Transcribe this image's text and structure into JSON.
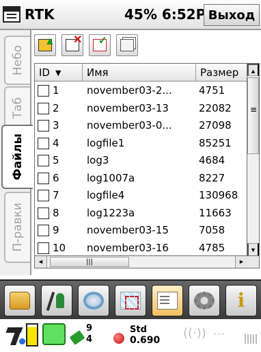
{
  "titlebar": {
    "app": "RTK",
    "status": "45% 6:52P",
    "exit_label": "Выход"
  },
  "side_tabs": [
    {
      "label": "Небо",
      "active": false
    },
    {
      "label": "Таб",
      "active": false
    },
    {
      "label": "Файлы",
      "active": true
    },
    {
      "label": "П-равки",
      "active": false
    }
  ],
  "toolbar": {
    "icons": [
      "import-icon",
      "delete-icon",
      "select-all-icon",
      "deselect-icon"
    ]
  },
  "table": {
    "columns": {
      "id": "ID",
      "name": "Имя",
      "size": "Размер"
    },
    "sort_icon": "▼",
    "rows": [
      {
        "id": "1",
        "name": "november03-2...",
        "size": "4751"
      },
      {
        "id": "2",
        "name": "november03-13",
        "size": "22082"
      },
      {
        "id": "3",
        "name": "november03-0...",
        "size": "27098"
      },
      {
        "id": "4",
        "name": "logfile1",
        "size": "85251"
      },
      {
        "id": "5",
        "name": "log3",
        "size": "4684"
      },
      {
        "id": "6",
        "name": "log1007a",
        "size": "8227"
      },
      {
        "id": "7",
        "name": "logfile4",
        "size": "130968"
      },
      {
        "id": "8",
        "name": "log1223a",
        "size": "11663"
      },
      {
        "id": "9",
        "name": "november03-15",
        "size": "7058"
      },
      {
        "id": "10",
        "name": "november03-16",
        "size": "4785"
      }
    ]
  },
  "scroll": {
    "up": "▲",
    "down": "▼",
    "left": "◄",
    "right": "►",
    "grip_v": "≡",
    "grip_h": "|||"
  },
  "appbar": {
    "icons": [
      "folder-icon",
      "survey-icon",
      "search-icon",
      "map-icon",
      "document-icon",
      "gear-icon",
      "info-icon"
    ],
    "info_glyph": "i"
  },
  "status": {
    "satellites": {
      "line1": "9",
      "line2": "4"
    },
    "fix": {
      "line1": "Std",
      "line2": "0.690"
    },
    "radio_glyph": "((·))",
    "dots": "···"
  },
  "colors": {
    "battery_fill": "#f8e400",
    "external_power": "#5fe05f",
    "fix_ball": "#c01010"
  }
}
